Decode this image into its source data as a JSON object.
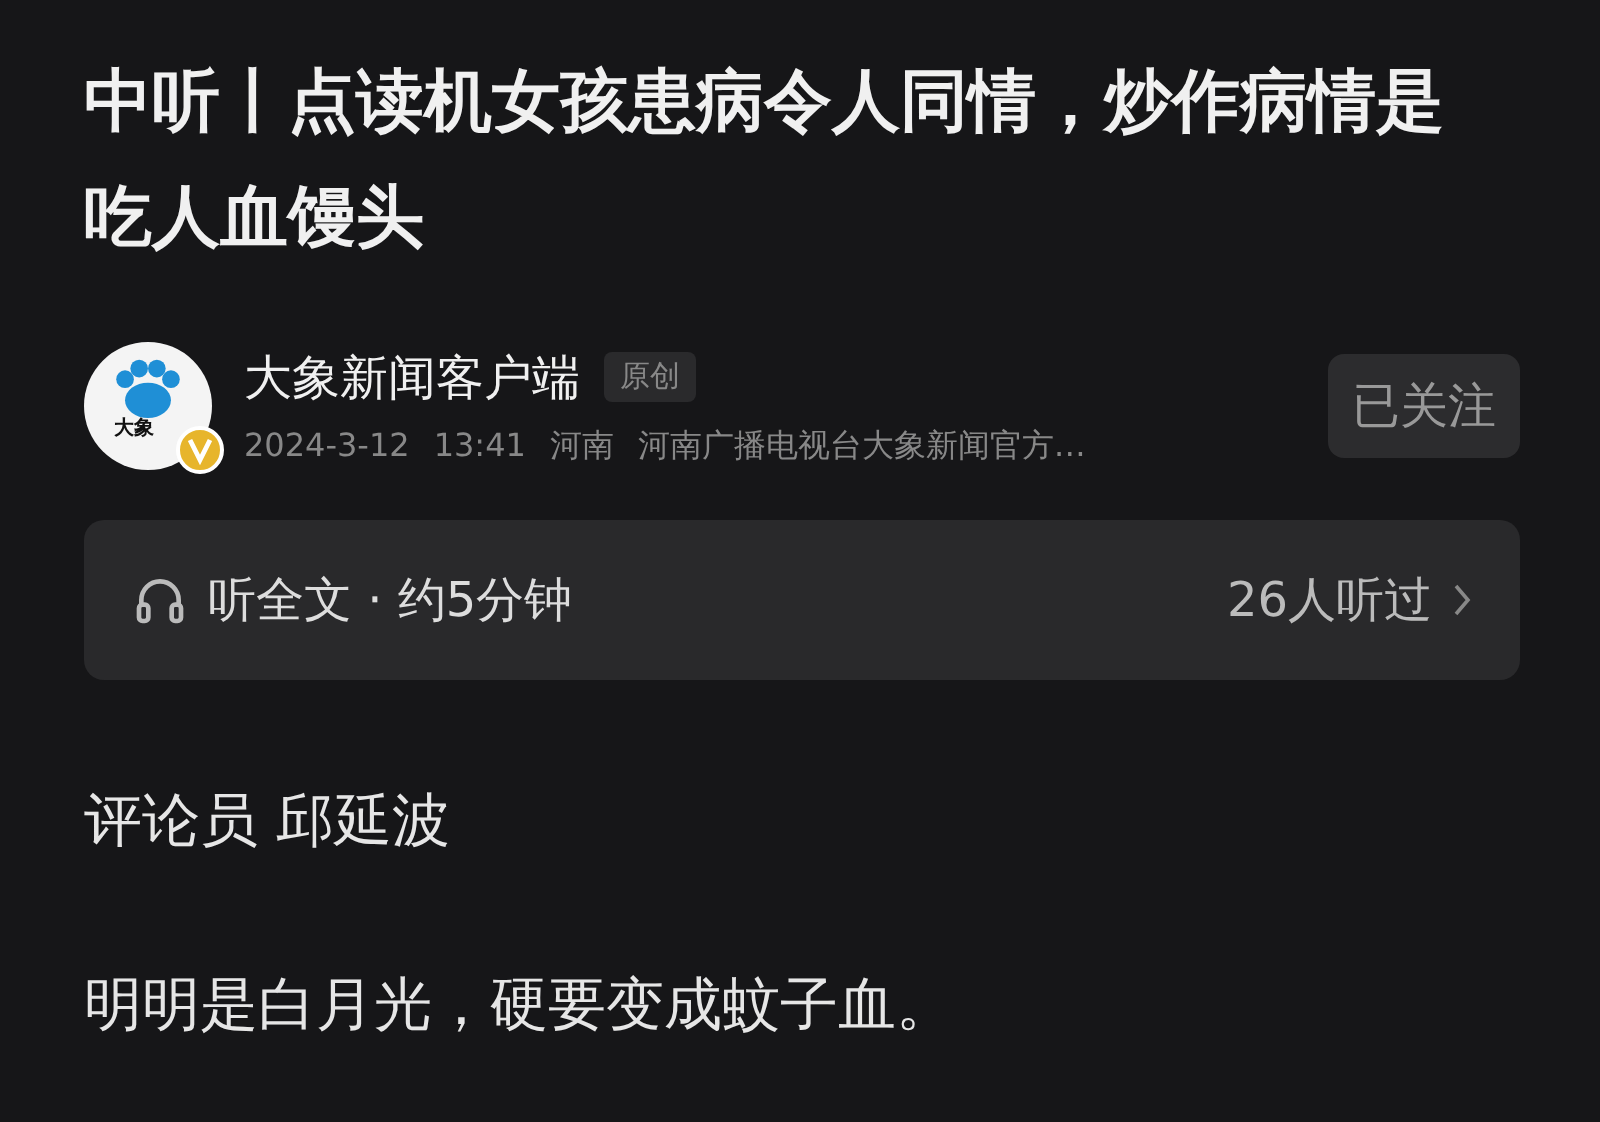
{
  "article": {
    "title": "中听丨点读机女孩患病令人同情，炒作病情是吃人血馒头"
  },
  "author": {
    "logo_text": "大象",
    "verified": true,
    "name": "大象新闻客户端",
    "tag": "原创",
    "date": "2024-3-12",
    "time": "13:41",
    "region": "河南",
    "description": "河南广播电视台大象新闻官方…",
    "follow_label": "已关注",
    "followed": true
  },
  "audio": {
    "label": "听全文 · 约5分钟",
    "listeners": "26人听过"
  },
  "paragraphs": [
    "评论员 邱延波",
    "明明是白月光，硬要变成蚊子血。"
  ]
}
